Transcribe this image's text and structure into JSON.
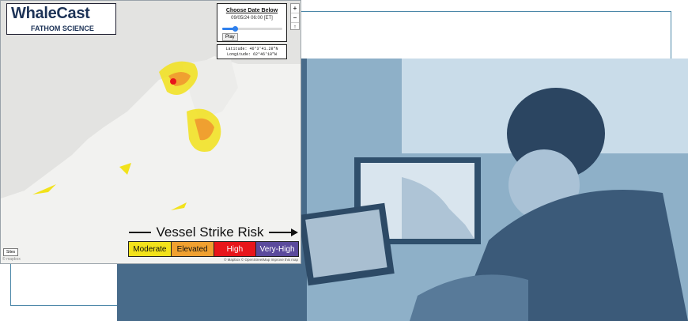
{
  "brand": {
    "title": "WhaleCast",
    "subtitle": "FATHOM SCIENCE"
  },
  "date_panel": {
    "heading": "Choose Date Below",
    "date": "09/05/24 06:00 [ET]",
    "play_label": "Play",
    "slider_fraction": 0.22
  },
  "coordinates": {
    "latitude": "Latitude:  46°3'41.28\"N",
    "longitude": "Longitude:  62°46'18\"W"
  },
  "zoom": {
    "in": "+",
    "out": "−",
    "reset": "↑"
  },
  "legend": {
    "title": "Vessel Strike Risk",
    "items": [
      {
        "label": "Moderate",
        "color": "#f2e21b"
      },
      {
        "label": "Elevated",
        "color": "#f0a030"
      },
      {
        "label": "High",
        "color": "#e8161b"
      },
      {
        "label": "Very-High",
        "color": "#5b4a9c"
      }
    ]
  },
  "scale_button": "Sites",
  "attribution": "© Mapbox © OpenStreetMap Improve this map",
  "mapbox": "© mapbox",
  "colors": {
    "frame": "#4a86a8",
    "photo_tint": "#7c9db8",
    "brand": "#1d3357"
  }
}
